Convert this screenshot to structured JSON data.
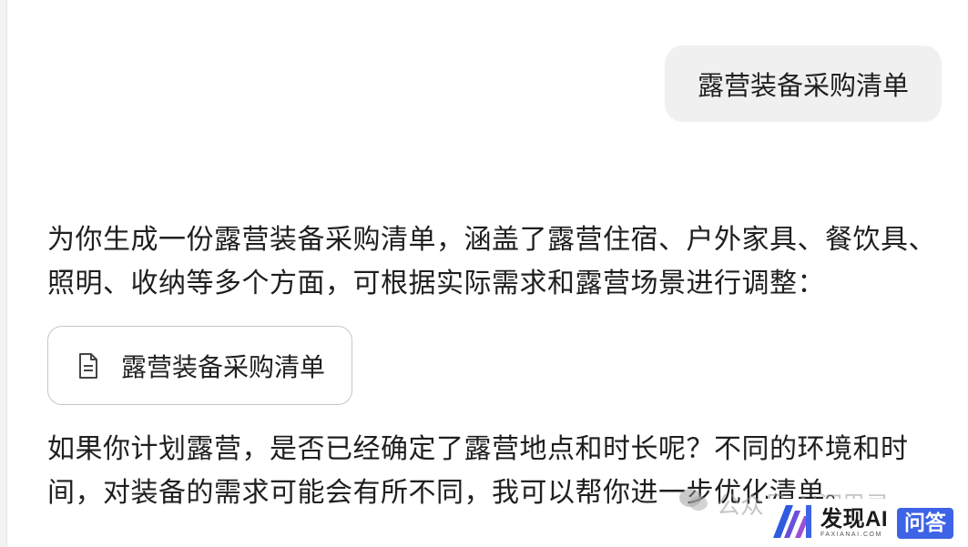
{
  "user_message": {
    "text": "露营装备采购清单"
  },
  "assistant": {
    "intro": "为你生成一份露营装备采购清单，涵盖了露营住宿、户外家具、餐饮具、照明、收纳等多个方面，可根据实际需求和露营场景进行调整：",
    "document": {
      "icon": "document-icon",
      "title": "露营装备采购清单"
    },
    "followup": "如果你计划露营，是否已经确定了露营地点和时长呢？不同的环境和时间，对装备的需求可能会有所不同，我可以帮你进一步优化清单。"
  },
  "watermark": {
    "icon": "wechat-icon",
    "text": "公众号·AI沉思录"
  },
  "logo": {
    "name": "发现AI",
    "domain": "FAXIANAI.COM",
    "badge": "问答",
    "accent_color": "#3d63e6"
  }
}
